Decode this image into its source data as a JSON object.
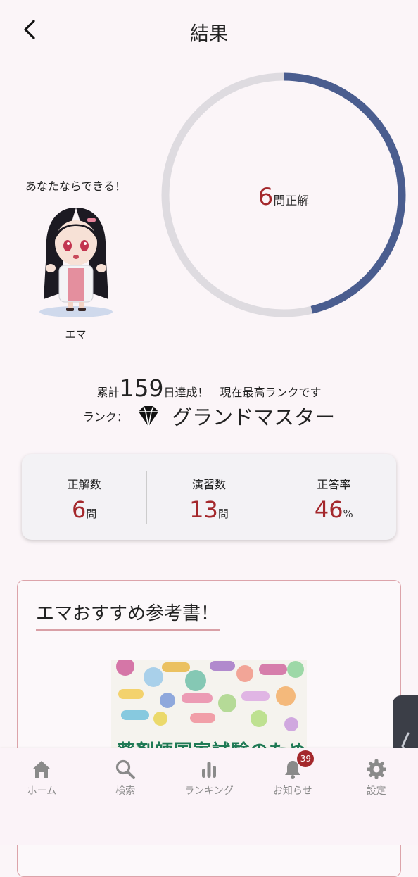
{
  "header": {
    "title": "結果"
  },
  "result": {
    "correct": "6",
    "correct_unit": "問正解",
    "total": 13,
    "ring_colors": {
      "track": "#dedbe0",
      "progress": "#4a5d8f"
    }
  },
  "character": {
    "speech": "あなたならできる！",
    "name": "エマ"
  },
  "achievement": {
    "prefix": "累計",
    "days": "159",
    "suffix": "日達成！　現在最高ランクです",
    "rank_label": "ランク：",
    "rank_icon": "diamond-icon",
    "rank_name": "グランドマスター"
  },
  "stats": [
    {
      "label": "正解数",
      "value": "6",
      "unit": "問"
    },
    {
      "label": "演習数",
      "value": "13",
      "unit": "問"
    },
    {
      "label": "正答率",
      "value": "46",
      "unit": "%"
    }
  ],
  "recommendation": {
    "title": "エマおすすめ参考書！",
    "book_title": "薬剤師国家試験のための"
  },
  "nav": [
    {
      "label": "ホーム",
      "icon": "home-icon"
    },
    {
      "label": "検索",
      "icon": "search-icon"
    },
    {
      "label": "ランキング",
      "icon": "ranking-icon"
    },
    {
      "label": "お知らせ",
      "icon": "bell-icon",
      "badge": "39"
    },
    {
      "label": "設定",
      "icon": "gear-icon"
    }
  ],
  "colors": {
    "accent_red": "#a4282c",
    "ring_blue": "#4a5d8f",
    "background": "#fbf5f8"
  }
}
